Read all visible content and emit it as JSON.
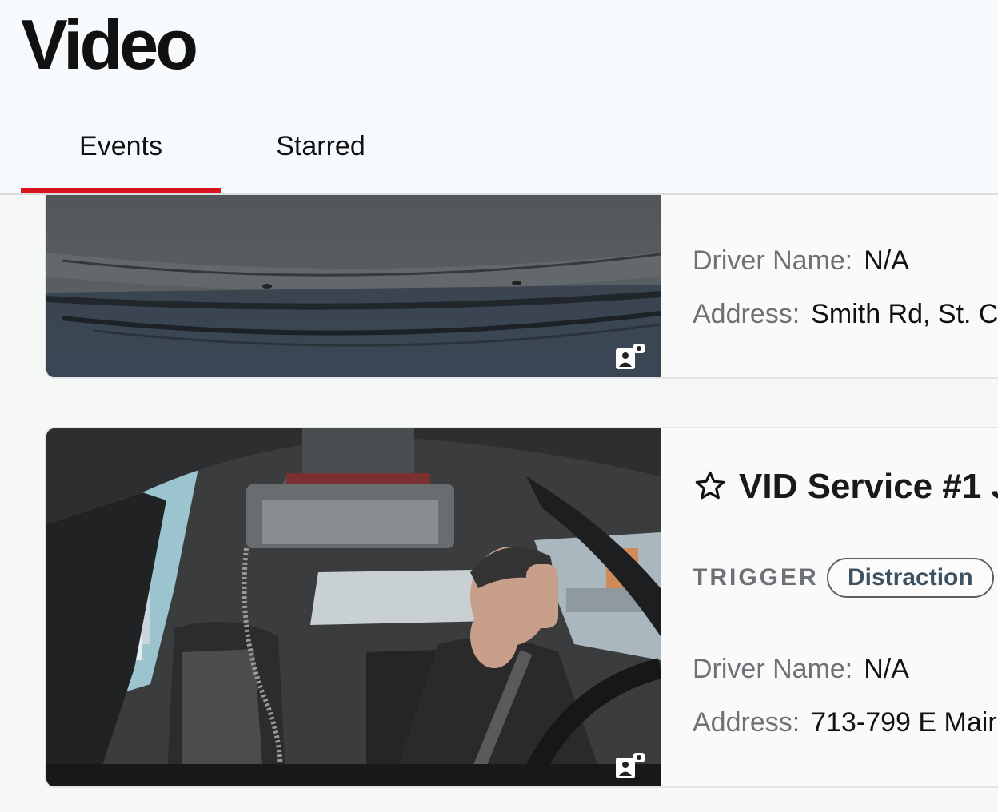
{
  "page": {
    "title": "Video"
  },
  "tabs": [
    {
      "label": "Events",
      "active": true
    },
    {
      "label": "Starred",
      "active": false
    }
  ],
  "colors": {
    "accent": "#d9141f",
    "badge_text": "#3d5363",
    "label_gray": "#6e7276"
  },
  "events": [
    {
      "driver_label": "Driver Name:",
      "driver_value": "N/A",
      "address_label": "Address:",
      "address_value": "Smith Rd, St. C",
      "camera_icon": "driver-camera-icon"
    },
    {
      "title": "VID Service #1 J",
      "starred": false,
      "trigger_label": "TRIGGER",
      "trigger_value": "Distraction",
      "driver_label": "Driver Name:",
      "driver_value": "N/A",
      "address_label": "Address:",
      "address_value": "713-799 E Mair",
      "camera_icon": "driver-camera-icon"
    }
  ]
}
